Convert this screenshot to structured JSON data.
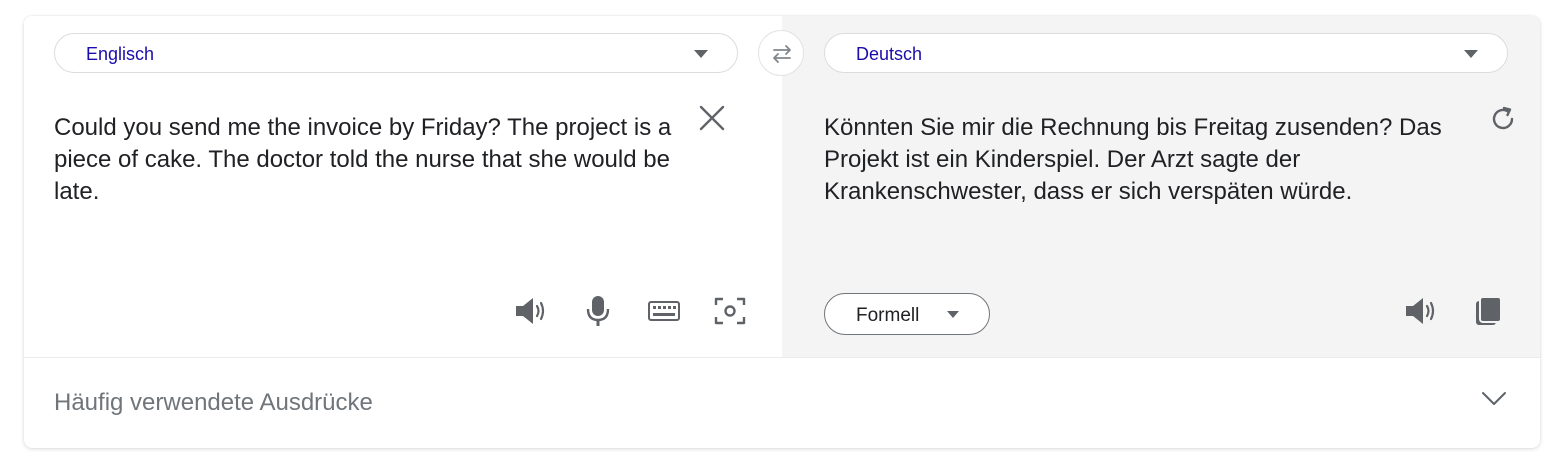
{
  "source": {
    "language": "Englisch",
    "text": "Could you send me the invoice by Friday? The project is a piece of cake. The doctor told the nurse that she would be late."
  },
  "target": {
    "language": "Deutsch",
    "text": "Könnten Sie mir die Rechnung bis Freitag zusenden? Das Projekt ist ein Kinderspiel. Der Arzt sagte der Krankenschwester, dass er sich verspäten würde.",
    "formality": "Formell"
  },
  "phrases": {
    "label": "Häufig verwendete Ausdrücke"
  },
  "icons": {
    "swap": "swap-arrows-icon",
    "clear": "close-icon",
    "retry": "refresh-icon",
    "speak": "speaker-icon",
    "mic": "microphone-icon",
    "keyboard": "keyboard-icon",
    "camera": "camera-scan-icon",
    "copy": "copy-icon",
    "expand": "chevron-down-icon"
  },
  "colors": {
    "language_link": "#1a0dab",
    "text": "#202124",
    "icon": "#5f6368",
    "target_pane_bg": "#f4f4f4",
    "muted": "#70757a"
  }
}
